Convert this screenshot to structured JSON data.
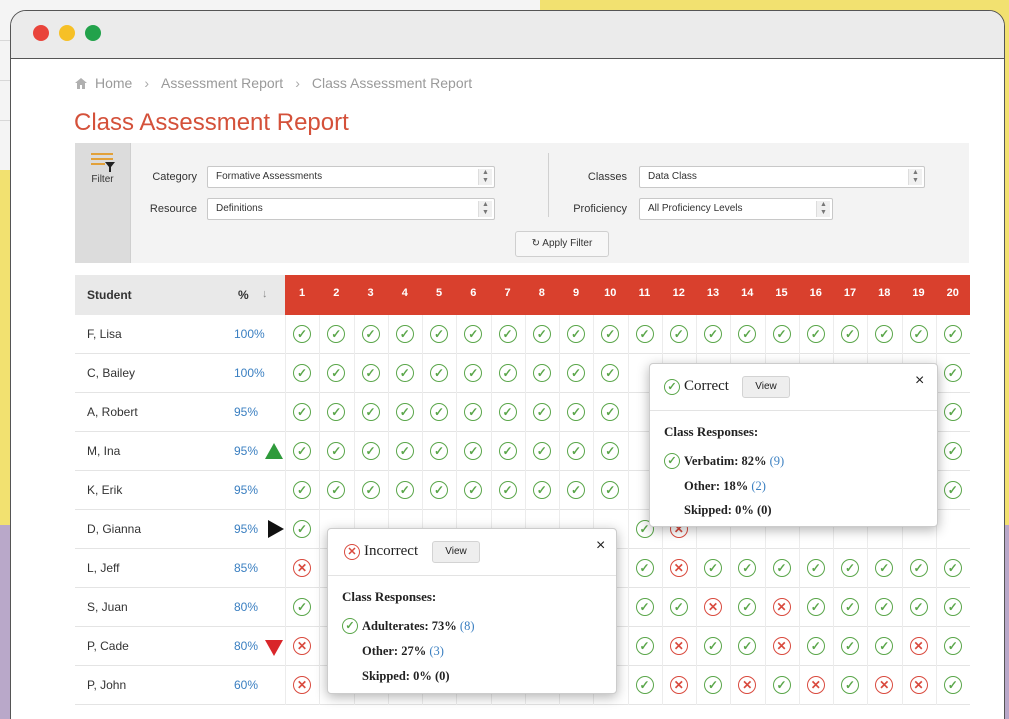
{
  "breadcrumb": [
    "Home",
    "Assessment Report",
    "Class Assessment Report"
  ],
  "page_title": "Class Assessment Report",
  "filter": {
    "button_label": "Filter",
    "category_label": "Category",
    "category_value": "Formative Assessments",
    "resource_label": "Resource",
    "resource_value": "Definitions",
    "classes_label": "Classes",
    "classes_value": "Data Class",
    "proficiency_label": "Proficiency",
    "proficiency_value": "All Proficiency Levels",
    "apply_label": "Apply Filter"
  },
  "table": {
    "student_header": "Student",
    "percent_header": "%",
    "sort_glyph": "↓",
    "questions": [
      "1",
      "2",
      "3",
      "4",
      "5",
      "6",
      "7",
      "8",
      "9",
      "10",
      "11",
      "12",
      "13",
      "14",
      "15",
      "16",
      "17",
      "18",
      "19",
      "20"
    ],
    "rows": [
      {
        "name": "F, Lisa",
        "pct": "100%",
        "trend": "",
        "marks": "cccccccccccccccccccc"
      },
      {
        "name": "C, Bailey",
        "pct": "100%",
        "trend": "",
        "marks": "cccccccccc_________c"
      },
      {
        "name": "A, Robert",
        "pct": "95%",
        "trend": "",
        "marks": "cccccccccc_________c"
      },
      {
        "name": "M, Ina",
        "pct": "95%",
        "trend": "up",
        "marks": "cccccccccc_________c"
      },
      {
        "name": "K, Erik",
        "pct": "95%",
        "trend": "",
        "marks": "cccccccccc_________c"
      },
      {
        "name": "D, Gianna",
        "pct": "95%",
        "trend": "right",
        "marks": "c_________cx________"
      },
      {
        "name": "L, Jeff",
        "pct": "85%",
        "trend": "",
        "marks": "x_________cxcccccccc"
      },
      {
        "name": "S, Juan",
        "pct": "80%",
        "trend": "",
        "marks": "c_________ccxcxccccc"
      },
      {
        "name": "P, Cade",
        "pct": "80%",
        "trend": "down",
        "marks": "x_________cxccxcccxc"
      },
      {
        "name": "P, John",
        "pct": "60%",
        "trend": "",
        "marks": "x_________cxcxcxcxxc"
      }
    ]
  },
  "popover_correct": {
    "title": "Correct",
    "view_label": "View",
    "close": "×",
    "heading": "Class Responses:",
    "line1_label": "Verbatim:",
    "line1_pct": "82%",
    "line1_count": "(9)",
    "line2_label": "Other:",
    "line2_pct": "18%",
    "line2_count": "(2)",
    "line3": "Skipped:  0% (0)"
  },
  "popover_incorrect": {
    "title": "Incorrect",
    "view_label": "View",
    "close": "×",
    "heading": "Class Responses:",
    "line1_label": "Adulterates:",
    "line1_pct": "73%",
    "line1_count": "(8)",
    "line2_label": "Other:",
    "line2_pct": "27%",
    "line2_count": "(3)",
    "line3": "Skipped:  0% (0)"
  },
  "icons": {
    "correct": "✓",
    "incorrect": "✕",
    "apply": "↻",
    "select_arrows": "▲▼"
  },
  "colors": {
    "accent": "#d9402d",
    "title": "#d4513a",
    "correct": "#5aa64a",
    "incorrect": "#d94a3e",
    "link": "#3a7fc1"
  }
}
